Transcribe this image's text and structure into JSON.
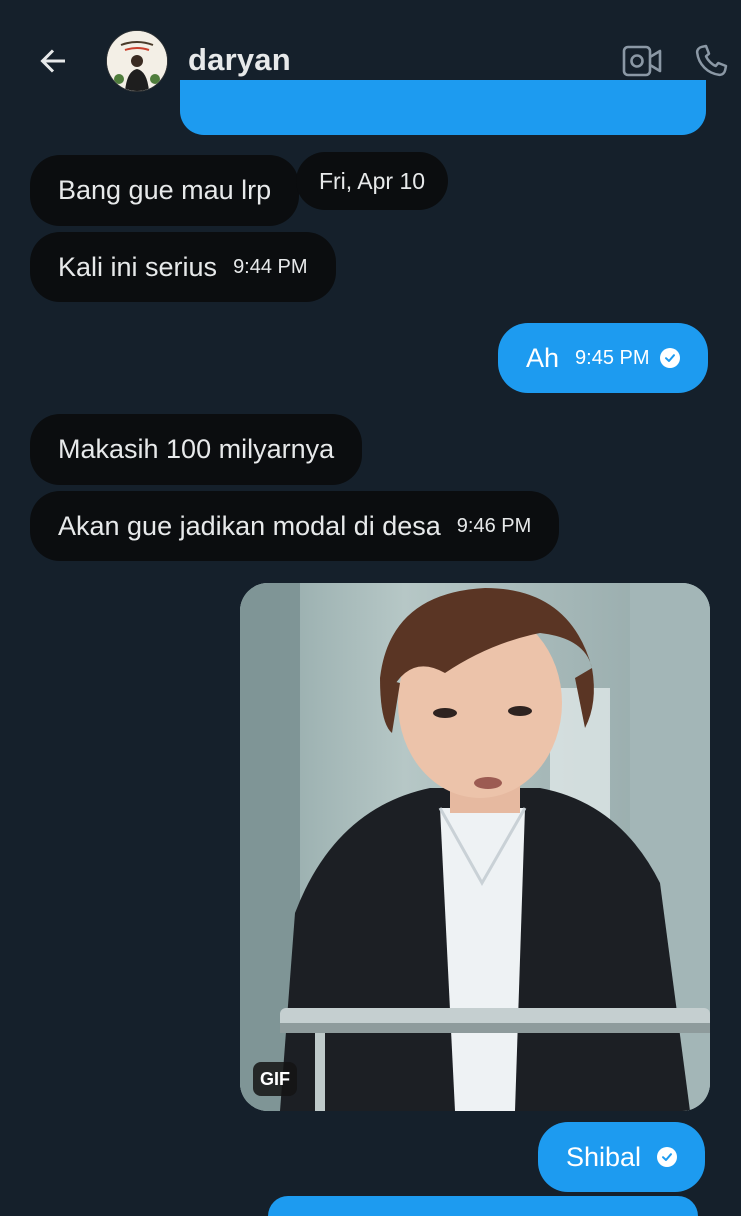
{
  "header": {
    "contact_name": "daryan",
    "back_icon": "arrow-left-icon",
    "video_icon": "video-call-icon",
    "phone_icon": "phone-icon"
  },
  "messages": {
    "date_separator": "Fri, Apr 10",
    "m1": {
      "text": "Bang gue mau lrp"
    },
    "m2": {
      "text": "Kali ini serius",
      "time": "9:44 PM"
    },
    "m3": {
      "text": "Ah",
      "time": "9:45 PM"
    },
    "m4": {
      "text": "Makasih 100 milyarnya"
    },
    "m5": {
      "text": "Akan gue jadikan modal di desa",
      "time": "9:46 PM"
    },
    "gif": {
      "badge": "GIF"
    },
    "m6": {
      "text": "Shibal"
    }
  },
  "colors": {
    "background": "#15202b",
    "sent_bubble": "#1d9bf0",
    "received_bubble": "#0b0d0f",
    "text": "#e7e9ea"
  }
}
